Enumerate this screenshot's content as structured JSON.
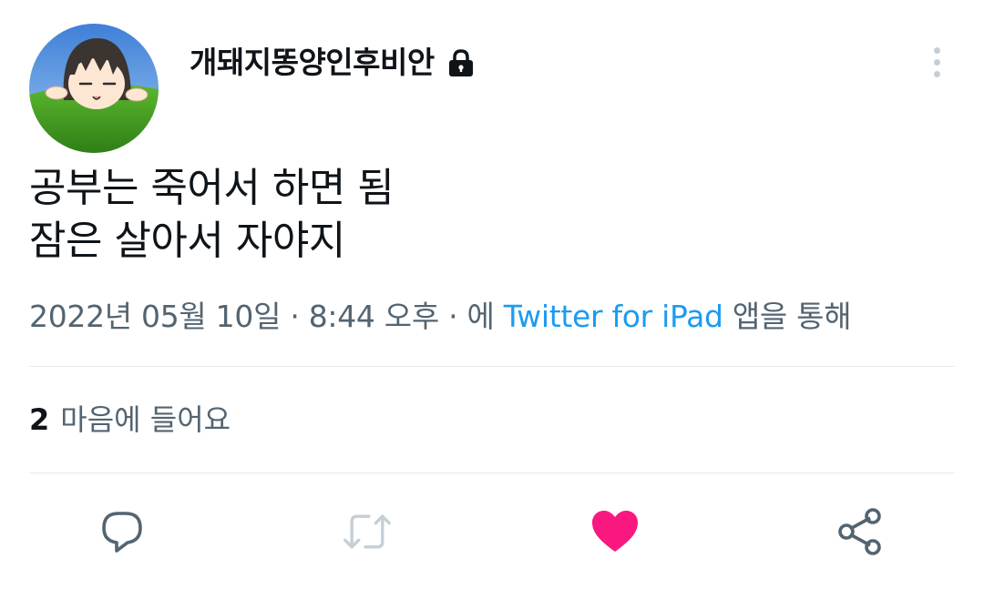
{
  "author": {
    "display_name": "개돼지똥양인후비안",
    "avatar_icon": "avatar-image",
    "protected_icon": "lock-icon"
  },
  "tweet": {
    "line1": "공부는 죽어서 하면 됨",
    "line2": "잠은 살아서 자야지"
  },
  "meta": {
    "date": "2022년 05월 10일",
    "sep1": " · ",
    "time": "8:44 오후",
    "sep2": " · ",
    "prefix": "에 ",
    "source": "Twitter for iPad",
    "suffix": " 앱을 통해"
  },
  "likes": {
    "count": "2",
    "label": "마음에 들어요"
  },
  "actions": {
    "reply_icon": "reply-icon",
    "retweet_icon": "retweet-icon",
    "like_icon": "heart-icon",
    "share_icon": "share-icon"
  },
  "colors": {
    "accent": "#1d9bf0",
    "like": "#f91880",
    "secondary_text": "#536471",
    "muted_icon": "#c4cfd6"
  }
}
